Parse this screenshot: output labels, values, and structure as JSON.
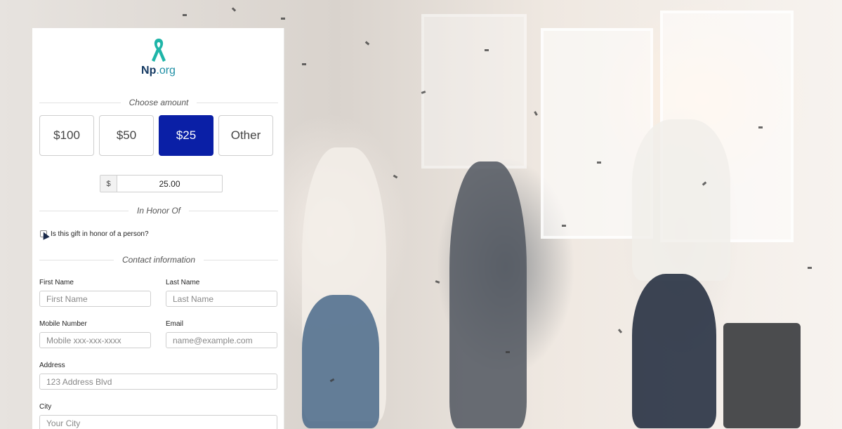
{
  "logo": {
    "name_bold": "Np",
    "name_rest": ".org",
    "icon": "ribbon-icon"
  },
  "amount_section": {
    "title": "Choose amount",
    "options": [
      "$100",
      "$50",
      "$25",
      "Other"
    ],
    "selected": "$25",
    "currency_prefix": "$",
    "amount_value": "25.00"
  },
  "honor_section": {
    "title": "In Honor Of",
    "checkbox_label": "Is this gift in honor of a person?"
  },
  "contact_section": {
    "title": "Contact information",
    "first_name_label": "First Name",
    "first_name_placeholder": "First Name",
    "last_name_label": "Last Name",
    "last_name_placeholder": "Last Name",
    "mobile_label": "Mobile Number",
    "mobile_placeholder": "Mobile xxx-xxx-xxxx",
    "email_label": "Email",
    "email_placeholder": "name@example.com",
    "address_label": "Address",
    "address_placeholder": "123 Address Blvd",
    "city_label": "City",
    "city_placeholder": "Your City"
  },
  "colors": {
    "selected_amount_bg": "#0a1fa6",
    "logo_teal": "#1fb5a8",
    "logo_navy": "#153a63"
  }
}
